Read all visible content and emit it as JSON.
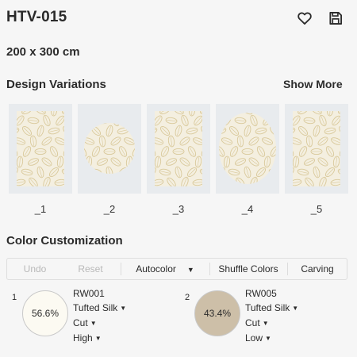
{
  "header": {
    "title": "HTV-015",
    "size": "200 x 300 cm",
    "favorite_icon": "heart-icon",
    "save_icon": "save-icon"
  },
  "design_variations": {
    "title": "Design Variations",
    "show_more": "Show More",
    "items": [
      {
        "label": "_1",
        "shape": "rectangle"
      },
      {
        "label": "_2",
        "shape": "circle"
      },
      {
        "label": "_3",
        "shape": "rectangle"
      },
      {
        "label": "_4",
        "shape": "oval"
      },
      {
        "label": "_5",
        "shape": "rectangle"
      }
    ]
  },
  "color_customization": {
    "title": "Color Customization",
    "toolbar": {
      "undo": "Undo",
      "reset": "Reset",
      "autocolor": "Autocolor",
      "shuffle": "Shuffle Colors",
      "carving": "Carving"
    },
    "colors": [
      {
        "index": "1",
        "percent": "56.6%",
        "code": "RW001",
        "material": "Tufted Silk",
        "cut": "Cut",
        "height": "High",
        "hex": "#fcfaf2"
      },
      {
        "index": "2",
        "percent": "43.4%",
        "code": "RW005",
        "material": "Tufted Silk",
        "cut": "Cut",
        "height": "Low",
        "hex": "#cdbfa8"
      }
    ]
  },
  "colors": {
    "rug_background": "#f4efe0",
    "rug_pattern": "#d9c99b",
    "tile_background": "#e8ebee"
  }
}
